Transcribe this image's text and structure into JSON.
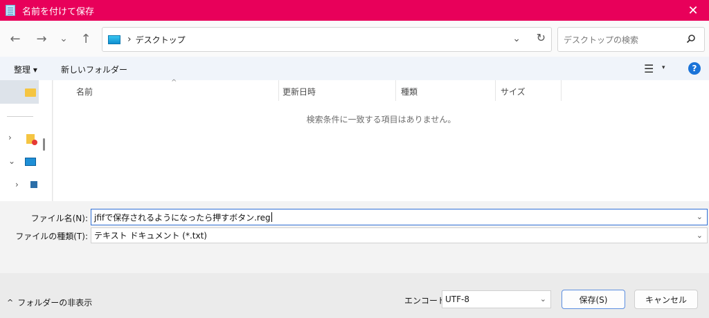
{
  "window": {
    "title": "名前を付けて保存",
    "close_glyph": "✕"
  },
  "nav": {
    "back_glyph": "←",
    "forward_glyph": "→",
    "recent_glyph": "⌄",
    "up_glyph": "↑",
    "address_separator": "›",
    "address_path": "デスクトップ",
    "address_dropdown_glyph": "⌄",
    "refresh_glyph": "↻",
    "search_placeholder": "デスクトップの検索"
  },
  "toolbar": {
    "organize_label": "整理 ▾",
    "new_folder_label": "新しいフォルダー",
    "view_glyph": "☰",
    "view_dropdown_glyph": "▾",
    "help_glyph": "?"
  },
  "sidebar": {
    "chevron_collapsed": "›",
    "chevron_expanded": "⌄"
  },
  "filelist": {
    "columns": [
      "名前",
      "更新日時",
      "種類",
      "サイズ"
    ],
    "sort_glyph": "^",
    "empty_message": "検索条件に一致する項目はありません。"
  },
  "form": {
    "filename_label": "ファイル名(N):",
    "filename_value": "jfifで保存されるようになったら押すボタン.reg",
    "filetype_label": "ファイルの種類(T):",
    "filetype_value": "テキスト ドキュメント (*.txt)",
    "dropdown_glyph": "⌄"
  },
  "footer": {
    "hide_folders_glyph": "^",
    "hide_folders_label": "フォルダーの非表示",
    "encoding_label": "エンコード:",
    "encoding_value": "UTF-8",
    "save_label": "保存(S)",
    "cancel_label": "キャンセル"
  },
  "colors": {
    "titlebar": "#e8005a",
    "accent": "#2f6fd6",
    "help": "#1a73d8"
  }
}
